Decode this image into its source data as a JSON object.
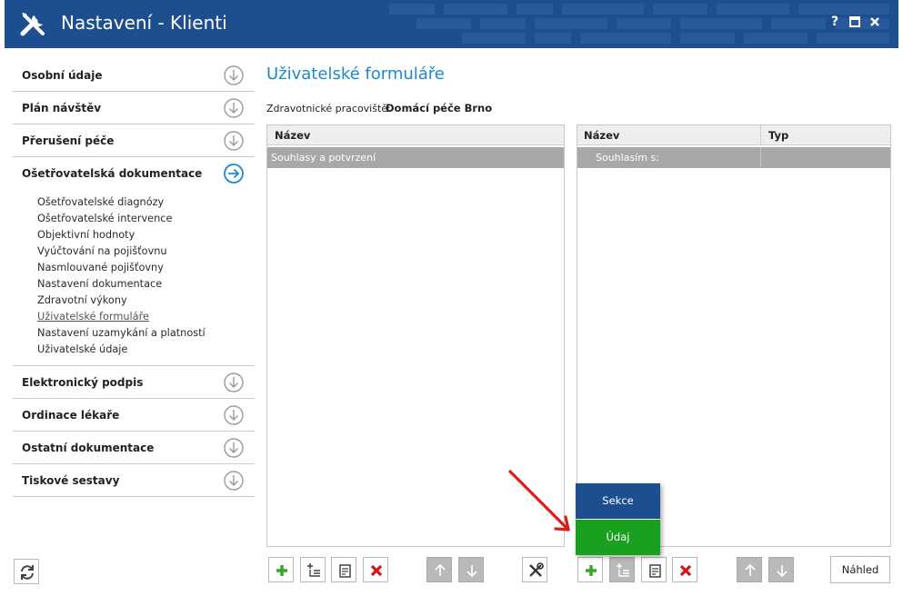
{
  "window": {
    "title": "Nastavení - Klienti",
    "controls": {
      "help": "?",
      "maximize": "▣",
      "close": "✕"
    }
  },
  "sidebar": {
    "sections_top": [
      {
        "label": "Osobní údaje",
        "icon": "chevron-down-circle-icon"
      },
      {
        "label": "Plán návštěv",
        "icon": "chevron-down-circle-icon"
      },
      {
        "label": "Přerušení péče",
        "icon": "chevron-down-circle-icon"
      }
    ],
    "active_section": {
      "label": "Ošetřovatelská dokumentace",
      "icon": "arrow-right-circle-icon"
    },
    "subitems": [
      "Ošetřovatelské diagnózy",
      "Ošetřovatelské intervence",
      "Objektivní hodnoty",
      "Vyúčtování na pojišťovnu",
      "Nasmlouvané pojišťovny",
      "Nastavení dokumentace",
      "Zdravotní výkony",
      "Uživatelské formuláře",
      "Nastavení uzamykání a platností",
      "Uživatelské údaje"
    ],
    "current_subitem_index": 7,
    "sections_bottom": [
      {
        "label": "Elektronický podpis",
        "icon": "chevron-down-circle-icon"
      },
      {
        "label": "Ordinace lékaře",
        "icon": "chevron-down-circle-icon"
      },
      {
        "label": "Ostatní dokumentace",
        "icon": "chevron-down-circle-icon"
      },
      {
        "label": "Tiskové sestavy",
        "icon": "chevron-down-circle-icon"
      }
    ]
  },
  "main": {
    "title": "Uživatelské formuláře",
    "workplace_label": "Zdravotnické pracoviště:",
    "workplace_value": "Domácí péče Brno",
    "left_grid": {
      "columns": [
        "Název"
      ],
      "rows": [
        [
          "Souhlasy a potvrzení"
        ]
      ]
    },
    "right_grid": {
      "columns": [
        "Název",
        "Typ"
      ],
      "rows": [
        [
          "Souhlasím s:",
          ""
        ]
      ]
    },
    "add_menu": {
      "options": [
        "Sekce",
        "Údaj"
      ],
      "colors": {
        "sekce": "#1d4e8f",
        "udaj": "#1aa01f"
      }
    },
    "preview_button": "Náhled"
  },
  "colors": {
    "accent": "#1a8ad0",
    "titlebar": "#1d4e8f",
    "add_green": "#3aa626",
    "delete_red": "#d21515",
    "annotation_arrow": "#e01b1b"
  }
}
